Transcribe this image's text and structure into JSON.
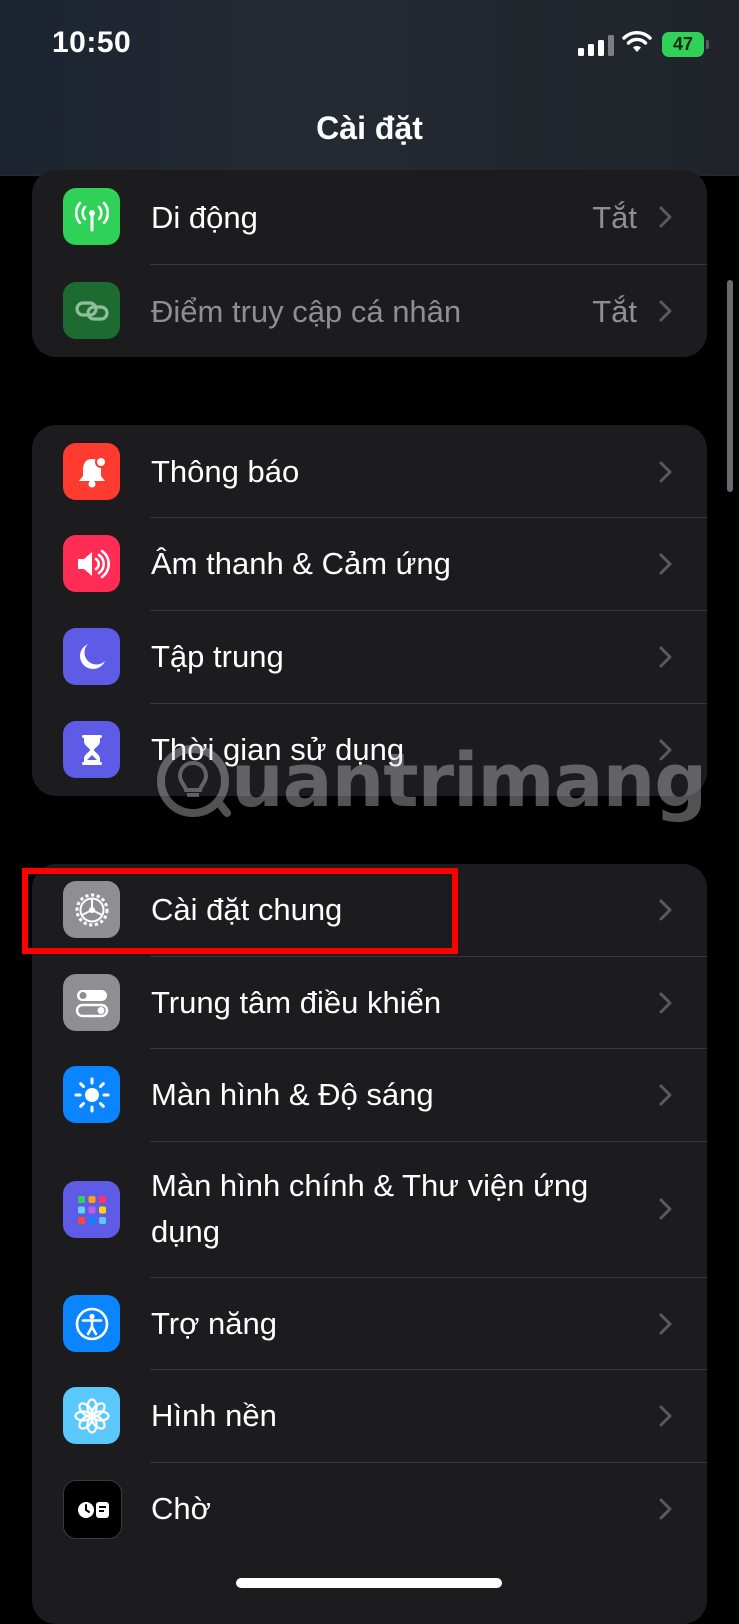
{
  "status": {
    "time": "10:50",
    "battery": "47"
  },
  "title": "Cài đặt",
  "groups": [
    {
      "items": [
        {
          "label": "Di động",
          "value": "Tắt",
          "icon": "antenna-icon",
          "color": "#30d158"
        },
        {
          "label": "Điểm truy cập cá nhân",
          "value": "Tắt",
          "icon": "link-icon",
          "color": "#1e6b32"
        }
      ]
    },
    {
      "items": [
        {
          "label": "Thông báo",
          "icon": "bell-icon",
          "color": "#ff3b30"
        },
        {
          "label": "Âm thanh & Cảm ứng",
          "icon": "speaker-icon",
          "color": "#ff2d55"
        },
        {
          "label": "Tập trung",
          "icon": "moon-icon",
          "color": "#5e5ce6"
        },
        {
          "label": "Thời gian sử dụng",
          "icon": "hourglass-icon",
          "color": "#5e5ce6"
        }
      ]
    },
    {
      "items": [
        {
          "label": "Cài đặt chung",
          "icon": "gear-icon",
          "color": "#8e8e93"
        },
        {
          "label": "Trung tâm điều khiển",
          "icon": "toggles-icon",
          "color": "#8e8e93"
        },
        {
          "label": "Màn hình & Độ sáng",
          "icon": "sun-icon",
          "color": "#0a84ff"
        },
        {
          "label": "Màn hình chính & Thư viện ứng dụng",
          "icon": "app-grid-icon",
          "color": "#5e5ce6"
        },
        {
          "label": "Trợ năng",
          "icon": "accessibility-icon",
          "color": "#0a84ff"
        },
        {
          "label": "Hình nền",
          "icon": "flower-icon",
          "color": "#5ac8fa"
        },
        {
          "label": "Chờ",
          "icon": "standby-icon",
          "color": "#000000"
        }
      ]
    }
  ],
  "watermark": "uantrimang"
}
